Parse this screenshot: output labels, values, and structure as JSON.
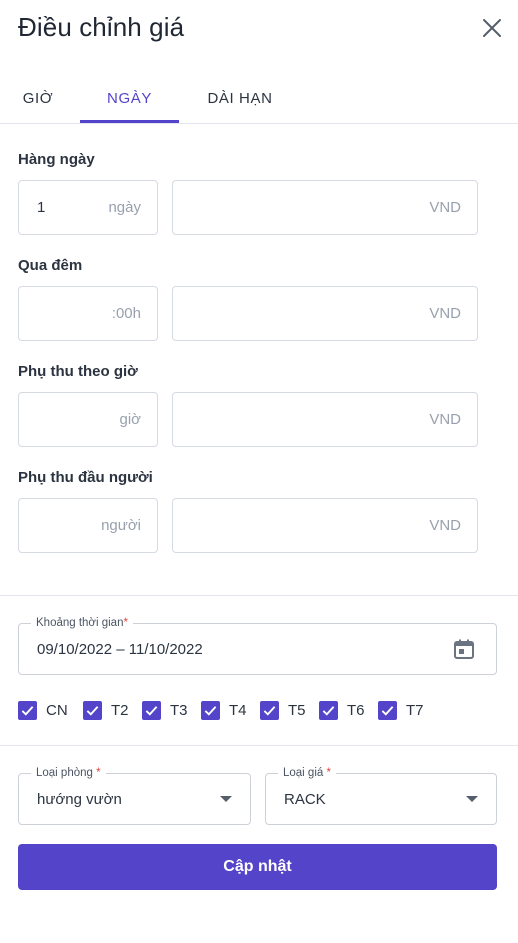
{
  "dialog": {
    "title": "Điều chỉnh giá"
  },
  "tabs": [
    {
      "label": "GIỜ",
      "active": false
    },
    {
      "label": "NGÀY",
      "active": true
    },
    {
      "label": "DÀI HẠN",
      "active": false
    }
  ],
  "daily": {
    "label": "Hàng ngày",
    "days_value": "1",
    "days_suffix": "ngày",
    "price_value": "",
    "price_suffix": "VND"
  },
  "overnight": {
    "label": "Qua đêm",
    "time_value": "",
    "time_suffix": ":00h",
    "price_value": "",
    "price_suffix": "VND"
  },
  "hourly_surcharge": {
    "label": "Phụ thu theo giờ",
    "hours_value": "",
    "hours_suffix": "giờ",
    "price_value": "",
    "price_suffix": "VND"
  },
  "per_person_surcharge": {
    "label": "Phụ thu đầu người",
    "persons_value": "",
    "persons_suffix": "người",
    "price_value": "",
    "price_suffix": "VND"
  },
  "date_range": {
    "label": "Khoảng thời gian",
    "required_mark": "*",
    "value": "09/10/2022 – 11/10/2022",
    "icon": "calendar-icon"
  },
  "weekdays": [
    {
      "label": "CN",
      "checked": true
    },
    {
      "label": "T2",
      "checked": true
    },
    {
      "label": "T3",
      "checked": true
    },
    {
      "label": "T4",
      "checked": true
    },
    {
      "label": "T5",
      "checked": true
    },
    {
      "label": "T6",
      "checked": true
    },
    {
      "label": "T7",
      "checked": true
    }
  ],
  "room_type": {
    "label": "Loại phòng",
    "required_mark": "*",
    "value": "hướng vườn"
  },
  "rate_type": {
    "label": "Loại giá",
    "required_mark": "*",
    "value": "RACK"
  },
  "submit": {
    "label": "Cập nhật"
  },
  "colors": {
    "accent": "#5344c9",
    "text": "#2b3440",
    "muted": "#98a1ad",
    "required": "#e0463b"
  }
}
